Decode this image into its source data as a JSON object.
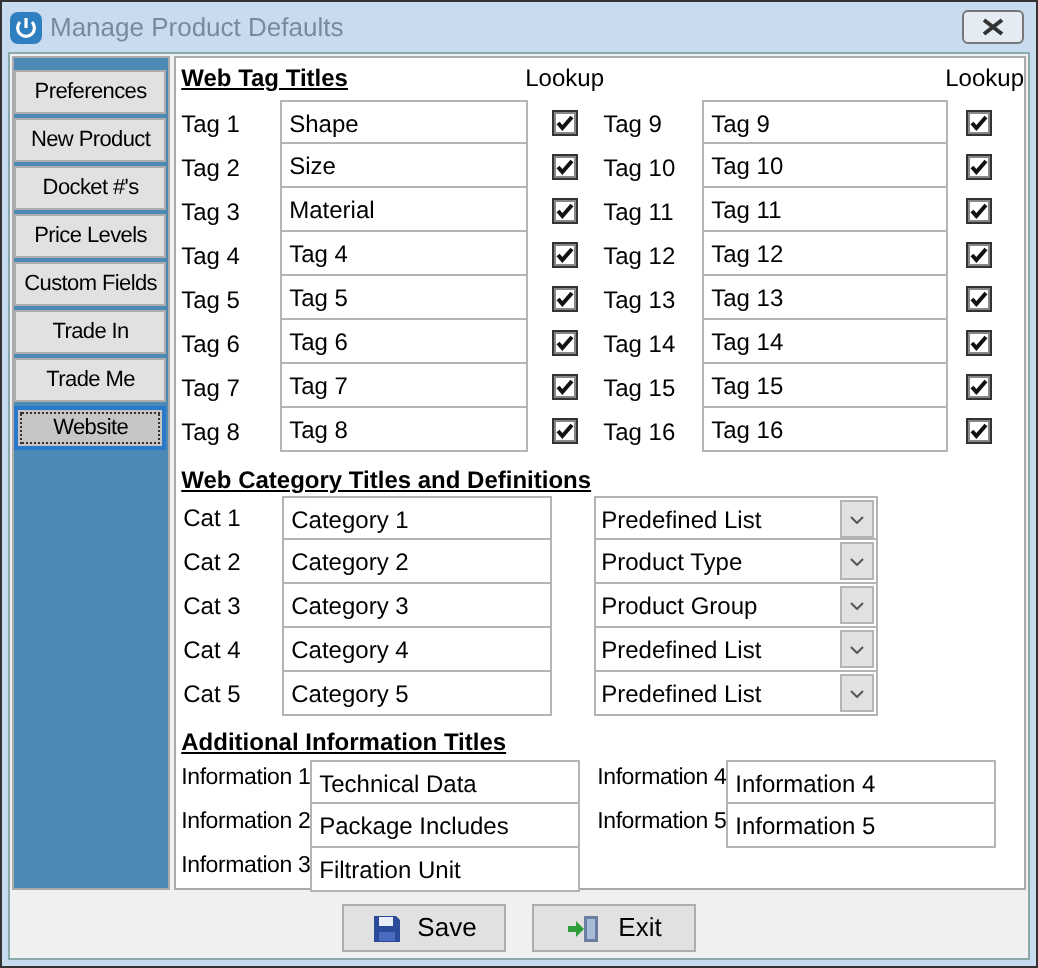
{
  "window": {
    "title": "Manage Product Defaults"
  },
  "sidebar": {
    "items": [
      {
        "label": "Preferences",
        "selected": false
      },
      {
        "label": "New Product",
        "selected": false
      },
      {
        "label": "Docket #'s",
        "selected": false
      },
      {
        "label": "Price Levels",
        "selected": false
      },
      {
        "label": "Custom Fields",
        "selected": false
      },
      {
        "label": "Trade In",
        "selected": false
      },
      {
        "label": "Trade Me",
        "selected": false
      },
      {
        "label": "Website",
        "selected": true
      }
    ]
  },
  "web_tags": {
    "heading": "Web Tag Titles",
    "lookup_headers": [
      "Lookup",
      "Lookup"
    ],
    "tags": [
      {
        "label": "Tag 1",
        "value": "Shape",
        "lookup": true
      },
      {
        "label": "Tag 2",
        "value": "Size",
        "lookup": true
      },
      {
        "label": "Tag 3",
        "value": "Material",
        "lookup": true
      },
      {
        "label": "Tag 4",
        "value": "Tag 4",
        "lookup": true
      },
      {
        "label": "Tag 5",
        "value": "Tag 5",
        "lookup": true
      },
      {
        "label": "Tag 6",
        "value": "Tag 6",
        "lookup": true
      },
      {
        "label": "Tag 7",
        "value": "Tag 7",
        "lookup": true
      },
      {
        "label": "Tag 8",
        "value": "Tag 8",
        "lookup": true
      },
      {
        "label": "Tag 9",
        "value": "Tag 9",
        "lookup": true
      },
      {
        "label": "Tag 10",
        "value": "Tag 10",
        "lookup": true
      },
      {
        "label": "Tag 11",
        "value": "Tag 11",
        "lookup": true
      },
      {
        "label": "Tag 12",
        "value": "Tag 12",
        "lookup": true
      },
      {
        "label": "Tag 13",
        "value": "Tag 13",
        "lookup": true
      },
      {
        "label": "Tag 14",
        "value": "Tag 14",
        "lookup": true
      },
      {
        "label": "Tag 15",
        "value": "Tag 15",
        "lookup": true
      },
      {
        "label": "Tag 16",
        "value": "Tag 16",
        "lookup": true
      }
    ]
  },
  "categories": {
    "heading": "Web Category Titles and Definitions",
    "items": [
      {
        "label": "Cat 1",
        "value": "Category 1",
        "definition": "Predefined List"
      },
      {
        "label": "Cat 2",
        "value": "Category 2",
        "definition": "Product Type"
      },
      {
        "label": "Cat 3",
        "value": "Category 3",
        "definition": "Product Group"
      },
      {
        "label": "Cat 4",
        "value": "Category 4",
        "definition": "Predefined List"
      },
      {
        "label": "Cat 5",
        "value": "Category 5",
        "definition": "Predefined List"
      }
    ]
  },
  "information": {
    "heading": "Additional Information Titles",
    "items": [
      {
        "label": "Information 1",
        "value": "Technical Data"
      },
      {
        "label": "Information 2",
        "value": "Package Includes"
      },
      {
        "label": "Information 3",
        "value": "Filtration Unit"
      },
      {
        "label": "Information 4",
        "value": "Information 4"
      },
      {
        "label": "Information 5",
        "value": "Information 5"
      }
    ]
  },
  "buttons": [
    {
      "label": "Save",
      "kind": "save"
    },
    {
      "label": "Exit",
      "kind": "exit"
    }
  ]
}
